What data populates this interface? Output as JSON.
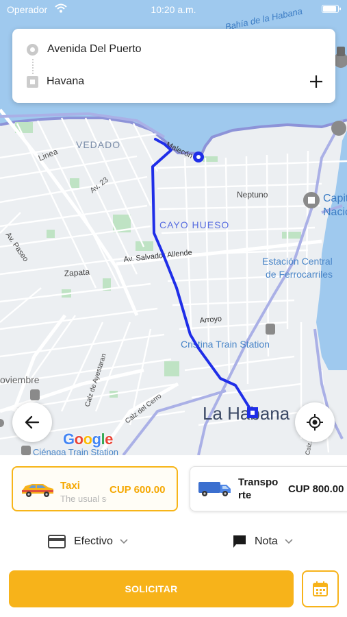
{
  "status_bar": {
    "carrier": "Operador",
    "time": "10:20 a.m."
  },
  "route": {
    "origin": "Avenida Del Puerto",
    "destination": "Havana"
  },
  "map": {
    "labels": {
      "bahia": "Bahía de la Habana",
      "vedado": "VEDADO",
      "linea": "Linea",
      "malecon": "Malecón",
      "av23": "Av. 23",
      "neptuno": "Neptuno",
      "capitolio": "Capit",
      "capitolio2": "Nacio",
      "cayo_hueso": "CAYO HUESO",
      "av_paseo": "Av. Paseo",
      "salvador_allende": "Av. Salvador Allende",
      "zapata": "Zapata",
      "estacion1": "Estación Central",
      "estacion2": "de Ferrocarriles",
      "arroyo": "Arroyo",
      "cristina": "Cristina Train Station",
      "noviembre": "oviembre",
      "ayestaran": "Calz de Ayestaran",
      "cerro": "Calz del Cerro",
      "cerro2": "Calz. de Cerro",
      "la_habana": "La Habana",
      "cienaga": "Ciénaga Train Station"
    },
    "attribution": [
      "G",
      "o",
      "o",
      "g",
      "l",
      "e"
    ]
  },
  "services": [
    {
      "name": "Taxi",
      "description": "The usual service",
      "price": "CUP 600.00",
      "selected": true,
      "icon": "taxi-car-icon"
    },
    {
      "name": "Transporte",
      "name_line1": "Transpo",
      "name_line2": "rte",
      "price": "CUP 800.00",
      "selected": false,
      "icon": "truck-icon"
    }
  ],
  "payment": {
    "label": "Efectivo",
    "icon": "credit-card-icon"
  },
  "note": {
    "label": "Nota",
    "icon": "comment-icon"
  },
  "request_button": "SOLICITAR",
  "colors": {
    "accent": "#f7b31a",
    "route": "#1f2ee8",
    "water": "#9fc9ee"
  }
}
